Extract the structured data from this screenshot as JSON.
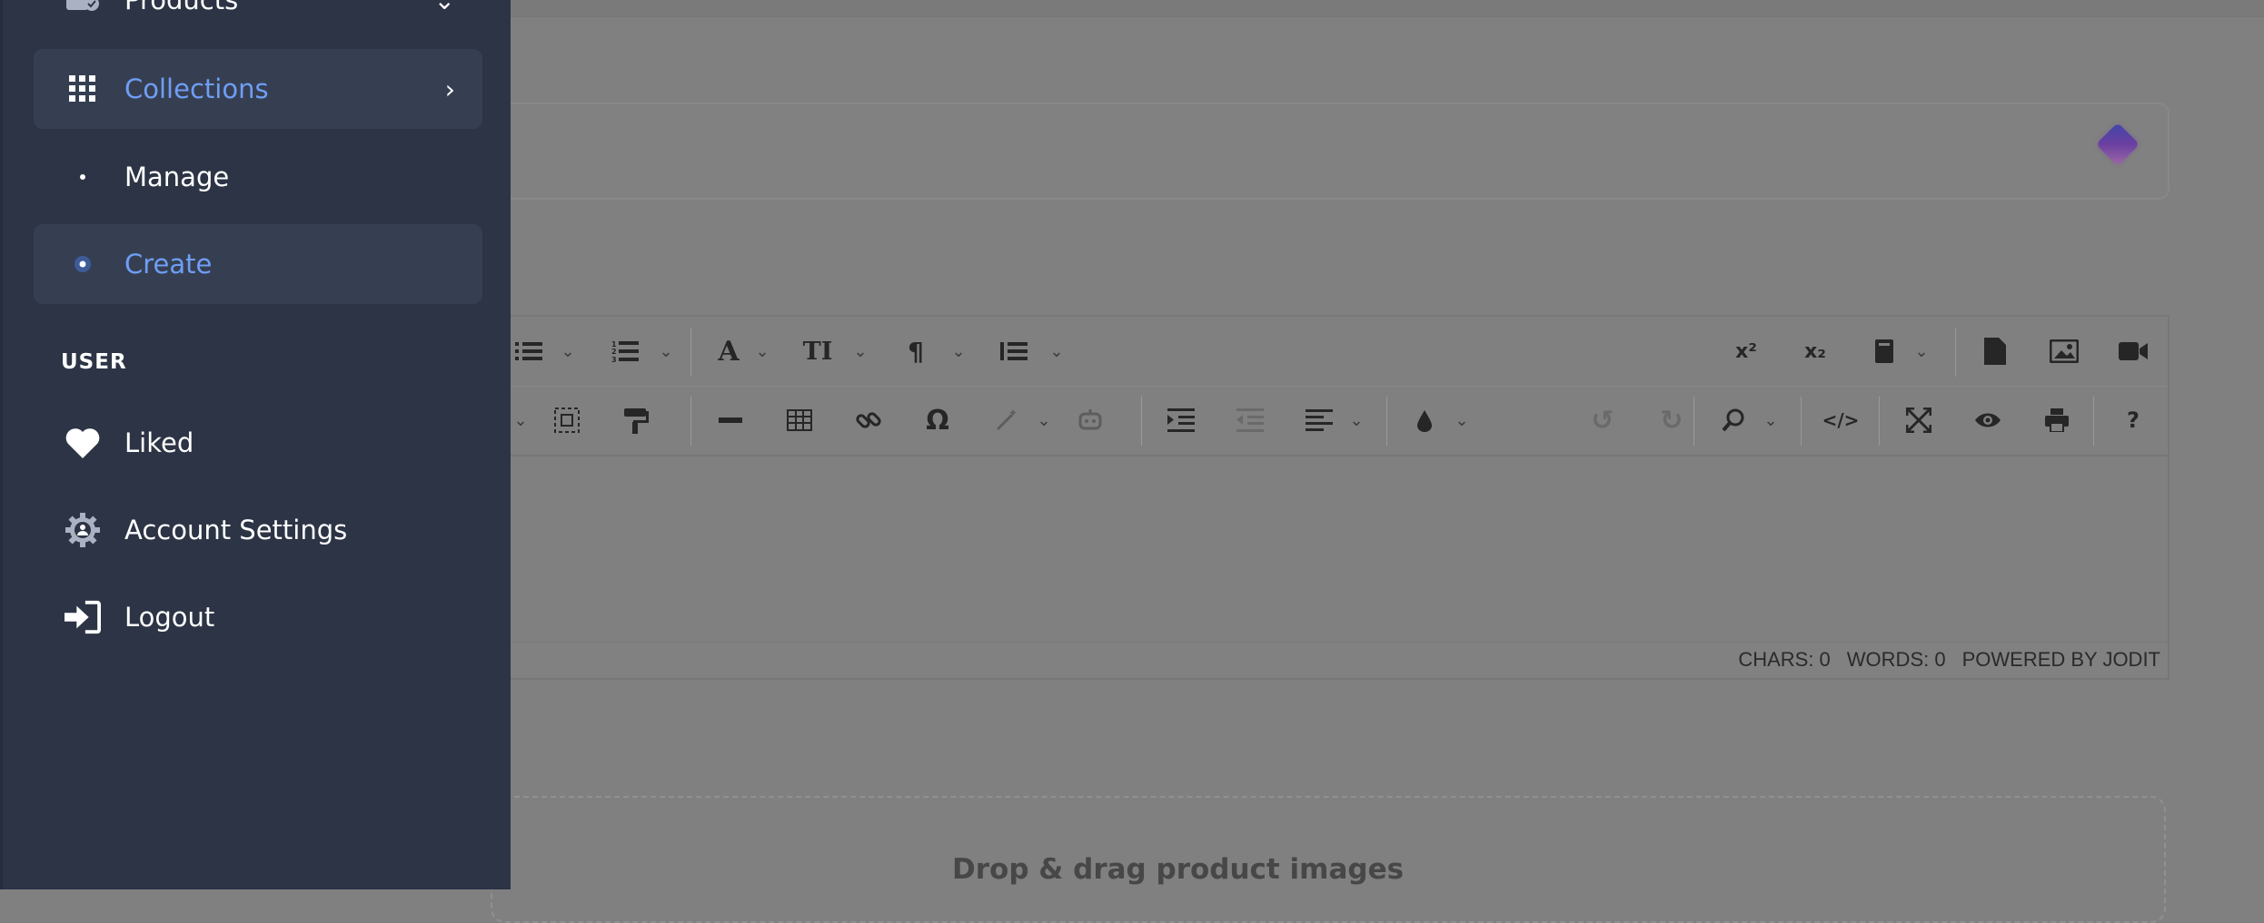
{
  "sidebar": {
    "items": [
      {
        "label": "Products",
        "icon": "products-icon",
        "chevron": "chevron-down-icon"
      },
      {
        "label": "Collections",
        "icon": "grid-icon",
        "chevron": "chevron-right-icon",
        "active": true
      },
      {
        "label": "Manage",
        "icon": "bullet-icon"
      },
      {
        "label": "Create",
        "icon": "radio-dot-icon",
        "active": true
      }
    ],
    "user_section": {
      "header": "USER",
      "items": [
        {
          "label": "Liked",
          "icon": "heart-icon"
        },
        {
          "label": "Account Settings",
          "icon": "gear-user-icon"
        },
        {
          "label": "Logout",
          "icon": "logout-icon"
        }
      ]
    }
  },
  "editor": {
    "status": {
      "chars": "CHARS: 0",
      "words": "WORDS: 0",
      "powered": "POWERED BY JODIT"
    },
    "toolbar_row1": [
      "ul-list-icon",
      "ol-list-icon",
      "font-icon",
      "font-size-icon",
      "paragraph-icon",
      "line-height-icon",
      "superscript-icon",
      "subscript-icon",
      "spellcheck-icon",
      "file-icon",
      "image-icon",
      "video-icon"
    ],
    "toolbar_row2": [
      "select-all-icon",
      "copy-format-icon",
      "hr-icon",
      "table-icon",
      "link-icon",
      "symbol-icon",
      "ai-commands-icon",
      "ai-assistant-icon",
      "indent-icon",
      "outdent-icon",
      "align-icon",
      "brush-icon",
      "undo-icon",
      "redo-icon",
      "find-icon",
      "source-icon",
      "fullsize-icon",
      "preview-icon",
      "print-icon",
      "about-icon"
    ]
  },
  "dropzone": {
    "text": "Drop & drag product images"
  },
  "colors": {
    "sidebar_bg": "#2c3445",
    "active_item_bg": "#363f52",
    "accent": "#6f9ef5",
    "overlay": "#808081"
  }
}
